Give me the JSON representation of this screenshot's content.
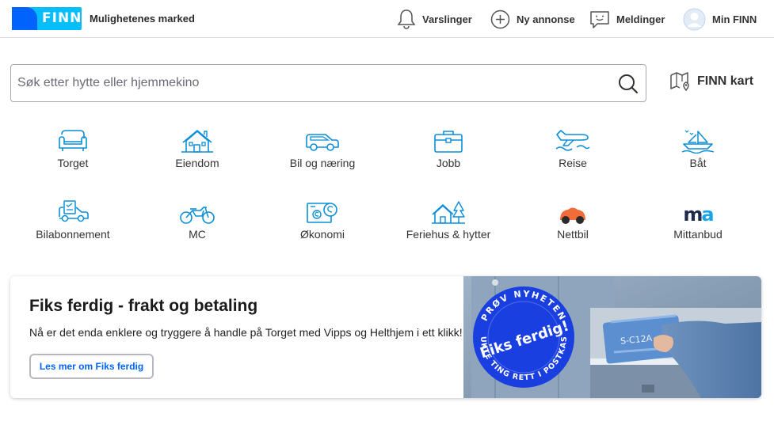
{
  "header": {
    "logo_text": "FINN",
    "tagline": "Mulighetenes marked",
    "nav": [
      {
        "label": "Varslinger",
        "icon": "bell-icon"
      },
      {
        "label": "Ny annonse",
        "icon": "plus-circle-icon"
      },
      {
        "label": "Meldinger",
        "icon": "chat-icon"
      },
      {
        "label": "Min FINN",
        "icon": "avatar-icon"
      }
    ],
    "brand_color": "#0063fb"
  },
  "search": {
    "placeholder": "Søk etter hytte eller hjemmekino",
    "value": ""
  },
  "finn_kart": {
    "label": "FINN kart",
    "icon": "map-pin-icon"
  },
  "categories": [
    {
      "label": "Torget",
      "icon": "sofa-icon"
    },
    {
      "label": "Eiendom",
      "icon": "house-icon"
    },
    {
      "label": "Bil og næring",
      "icon": "car-icon"
    },
    {
      "label": "Jobb",
      "icon": "briefcase-icon"
    },
    {
      "label": "Reise",
      "icon": "plane-icon"
    },
    {
      "label": "Båt",
      "icon": "boat-icon"
    },
    {
      "label": "Bilabonnement",
      "icon": "car-subscription-icon"
    },
    {
      "label": "MC",
      "icon": "motorcycle-icon"
    },
    {
      "label": "Økonomi",
      "icon": "coins-icon"
    },
    {
      "label": "Feriehus & hytter",
      "icon": "cabin-icon"
    },
    {
      "label": "Nettbil",
      "icon": "nettbil-logo-icon"
    },
    {
      "label": "Mittanbud",
      "icon": "mittanbud-logo-icon"
    }
  ],
  "mittanbud_logo_text": "ma",
  "promo": {
    "title": "Fiks ferdig - frakt og betaling",
    "text": "Nå er det enda enklere og tryggere å handle på Torget med Vipps og Helthjem i ett klikk!",
    "button": "Les mer om Fiks ferdig",
    "badge_center": "Fiks ferdig!",
    "badge_top": "PRØV NYHETEN",
    "badge_bottom": "BRUKTE TING RETT I POSTKASSA",
    "parcel_label": "S-C12A"
  }
}
